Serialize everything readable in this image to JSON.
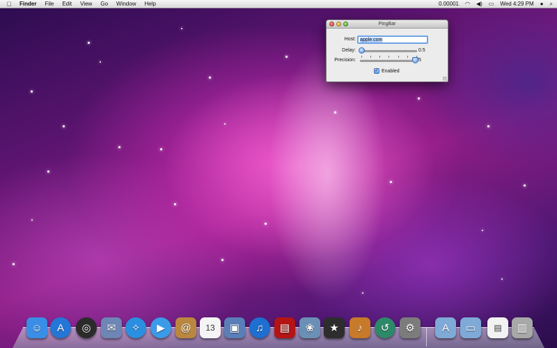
{
  "menubar": {
    "apple_icon": "apple-icon",
    "app_name": "Finder",
    "menus": [
      "File",
      "Edit",
      "View",
      "Go",
      "Window",
      "Help"
    ],
    "ping_value": "0.00001",
    "clock": "Wed 4:29 PM"
  },
  "pingbar_window": {
    "title": "PingBar",
    "host_label": "Host:",
    "host_value": "apple.com",
    "delay_label": "Delay:",
    "delay_value": "0.5",
    "delay_level": 0.0,
    "precision_label": "Precision:",
    "precision_value": "5",
    "precision_level": 1.0,
    "enabled_label": "Enabled",
    "enabled_checked": true
  },
  "dock": {
    "items": [
      {
        "name": "Finder",
        "icon": "finder-icon",
        "color": "#3a8ee6",
        "glyph": "☺"
      },
      {
        "name": "App Store",
        "icon": "app-store-icon",
        "color": "#2477d6",
        "glyph": "A"
      },
      {
        "name": "Dashboard",
        "icon": "dashboard-icon",
        "color": "#2b2b2b",
        "glyph": "◎"
      },
      {
        "name": "Mail",
        "icon": "mail-icon",
        "color": "#6d86b5",
        "glyph": "✉"
      },
      {
        "name": "Safari",
        "icon": "safari-icon",
        "color": "#2a8fe0",
        "glyph": "✧"
      },
      {
        "name": "iChat",
        "icon": "ichat-icon",
        "color": "#3b9be8",
        "glyph": "▶"
      },
      {
        "name": "Address Book",
        "icon": "address-book-icon",
        "color": "#b9873f",
        "glyph": "@"
      },
      {
        "name": "iCal",
        "icon": "ical-icon",
        "color": "#f4f4f4",
        "glyph": "13"
      },
      {
        "name": "Preview",
        "icon": "preview-icon",
        "color": "#5a7fb8",
        "glyph": "▣"
      },
      {
        "name": "iTunes",
        "icon": "itunes-icon",
        "color": "#1e6fd0",
        "glyph": "♫"
      },
      {
        "name": "Photo Booth",
        "icon": "photo-booth-icon",
        "color": "#b41414",
        "glyph": "▤"
      },
      {
        "name": "iPhoto",
        "icon": "iphoto-icon",
        "color": "#6b8fb5",
        "glyph": "❀"
      },
      {
        "name": "iMovie",
        "icon": "imovie-icon",
        "color": "#2d2d2d",
        "glyph": "★"
      },
      {
        "name": "GarageBand",
        "icon": "garageband-icon",
        "color": "#c77a2a",
        "glyph": "♪"
      },
      {
        "name": "Time Machine",
        "icon": "time-machine-icon",
        "color": "#2c8a6a",
        "glyph": "↺"
      },
      {
        "name": "System Preferences",
        "icon": "system-preferences-icon",
        "color": "#7c7c7c",
        "glyph": "⚙"
      },
      {
        "name": "Applications",
        "icon": "applications-folder-icon",
        "color": "#7fa9d6",
        "glyph": "A"
      },
      {
        "name": "Documents",
        "icon": "documents-folder-icon",
        "color": "#7fa9d6",
        "glyph": "▭"
      },
      {
        "name": "PDF",
        "icon": "pdf-document-icon",
        "color": "#f2f2f2",
        "glyph": "▤"
      },
      {
        "name": "Trash",
        "icon": "trash-icon",
        "color": "#a8a8a8",
        "glyph": "▥"
      }
    ]
  }
}
